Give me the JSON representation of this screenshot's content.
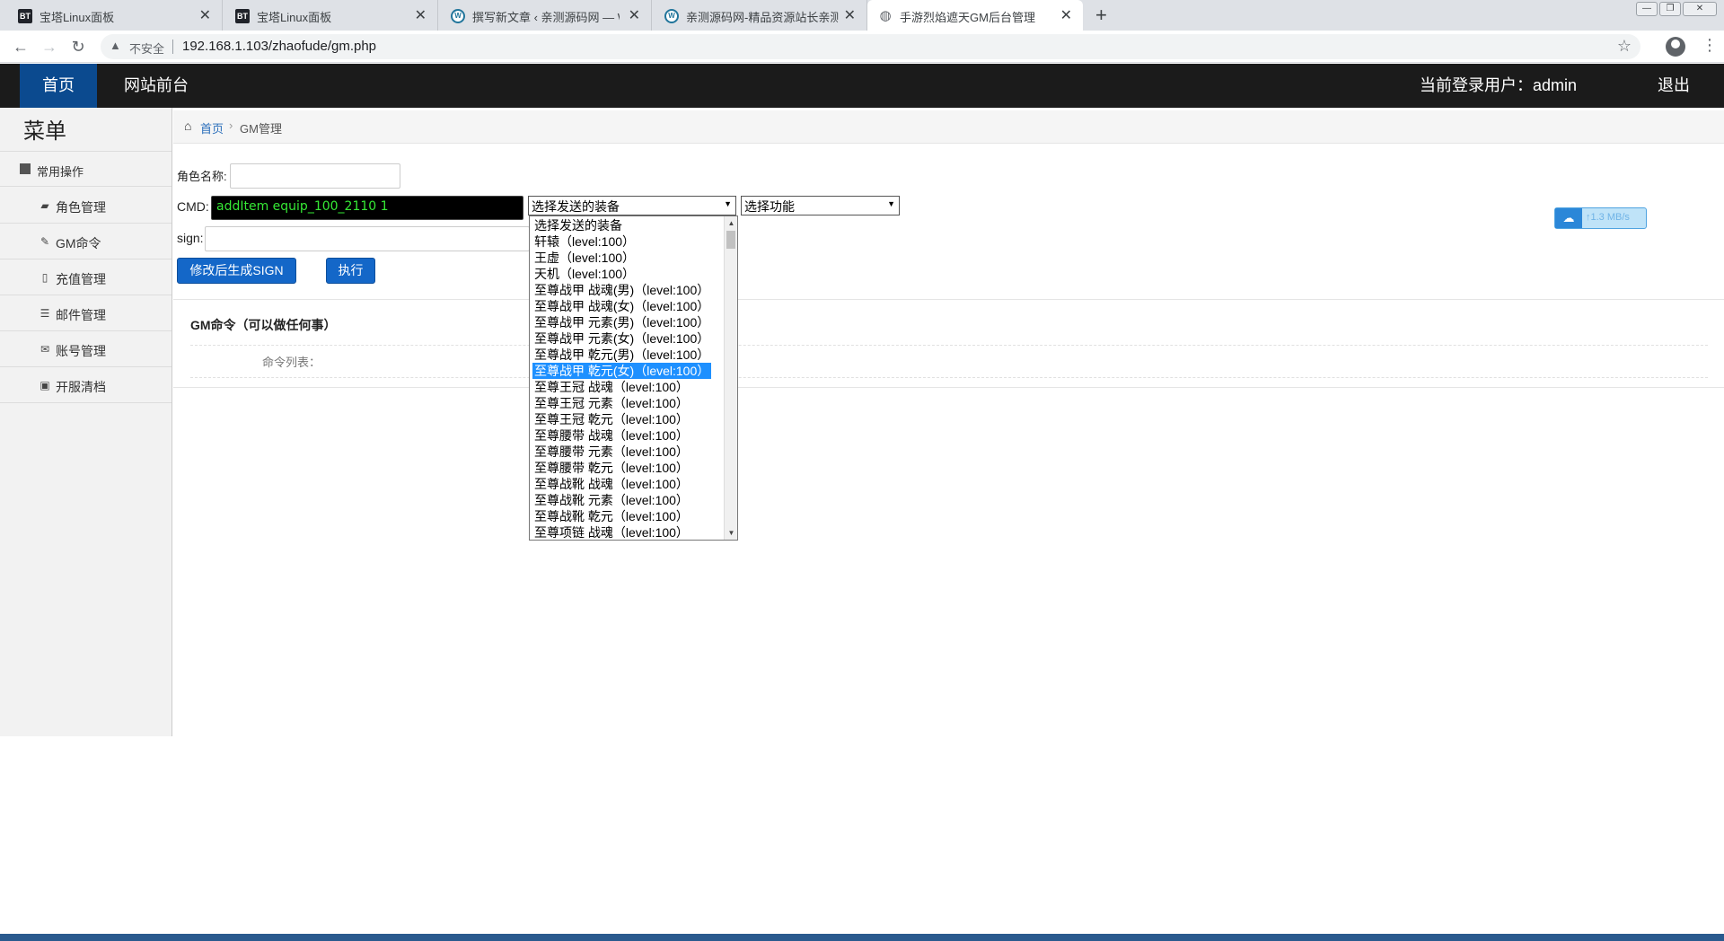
{
  "browser": {
    "tabs": [
      {
        "title": "宝塔Linux面板",
        "favicon": "BT"
      },
      {
        "title": "宝塔Linux面板",
        "favicon": "BT"
      },
      {
        "title": "撰写新文章 ‹ 亲测源码网 — Wo",
        "favicon": "W"
      },
      {
        "title": "亲测源码网-精品资源站长亲测",
        "favicon": "W"
      },
      {
        "title": "手游烈焰遮天GM后台管理",
        "favicon": "globe"
      }
    ],
    "security_label": "不安全",
    "url": "192.168.1.103/zhaofude/gm.php"
  },
  "header": {
    "home": "首页",
    "frontend": "网站前台",
    "user_label": "当前登录用户：admin",
    "logout": "退出"
  },
  "sidebar": {
    "title": "菜单",
    "group": "常用操作",
    "items": [
      {
        "label": "角色管理",
        "icon": "book-icon"
      },
      {
        "label": "GM命令",
        "icon": "wrench-icon"
      },
      {
        "label": "充值管理",
        "icon": "file-icon"
      },
      {
        "label": "邮件管理",
        "icon": "list-icon"
      },
      {
        "label": "账号管理",
        "icon": "mail-icon"
      },
      {
        "label": "开服清档",
        "icon": "picture-icon"
      }
    ]
  },
  "breadcrumb": {
    "home": "首页",
    "current": "GM管理"
  },
  "form": {
    "role_label": "角色名称:",
    "role_value": "",
    "cmd_label": "CMD:",
    "cmd_value": "addItem equip_100_2110 1",
    "equip_select": "选择发送的装备",
    "func_select": "选择功能",
    "sign_label": "sign:",
    "sign_value": "",
    "gen_sign_button": "修改后生成SIGN",
    "exec_button": "执行"
  },
  "gm_section": {
    "title": "GM命令（可以做任何事）",
    "list_label": "命令列表："
  },
  "dropdown": {
    "selected_index": 9,
    "options": [
      "选择发送的装备",
      "轩辕（level:100）",
      "王虚（level:100）",
      "天机（level:100）",
      "至尊战甲 战魂(男)（level:100）",
      "至尊战甲 战魂(女)（level:100）",
      "至尊战甲 元素(男)（level:100）",
      "至尊战甲 元素(女)（level:100）",
      "至尊战甲 乾元(男)（level:100）",
      "至尊战甲 乾元(女)（level:100）",
      "至尊王冠 战魂（level:100）",
      "至尊王冠 元素（level:100）",
      "至尊王冠 乾元（level:100）",
      "至尊腰带 战魂（level:100）",
      "至尊腰带 元素（level:100）",
      "至尊腰带 乾元（level:100）",
      "至尊战靴 战魂（level:100）",
      "至尊战靴 元素（level:100）",
      "至尊战靴 乾元（level:100）",
      "至尊项链 战魂（level:100）"
    ]
  },
  "speed_widget": {
    "value": "↑1.3 MB/s"
  }
}
